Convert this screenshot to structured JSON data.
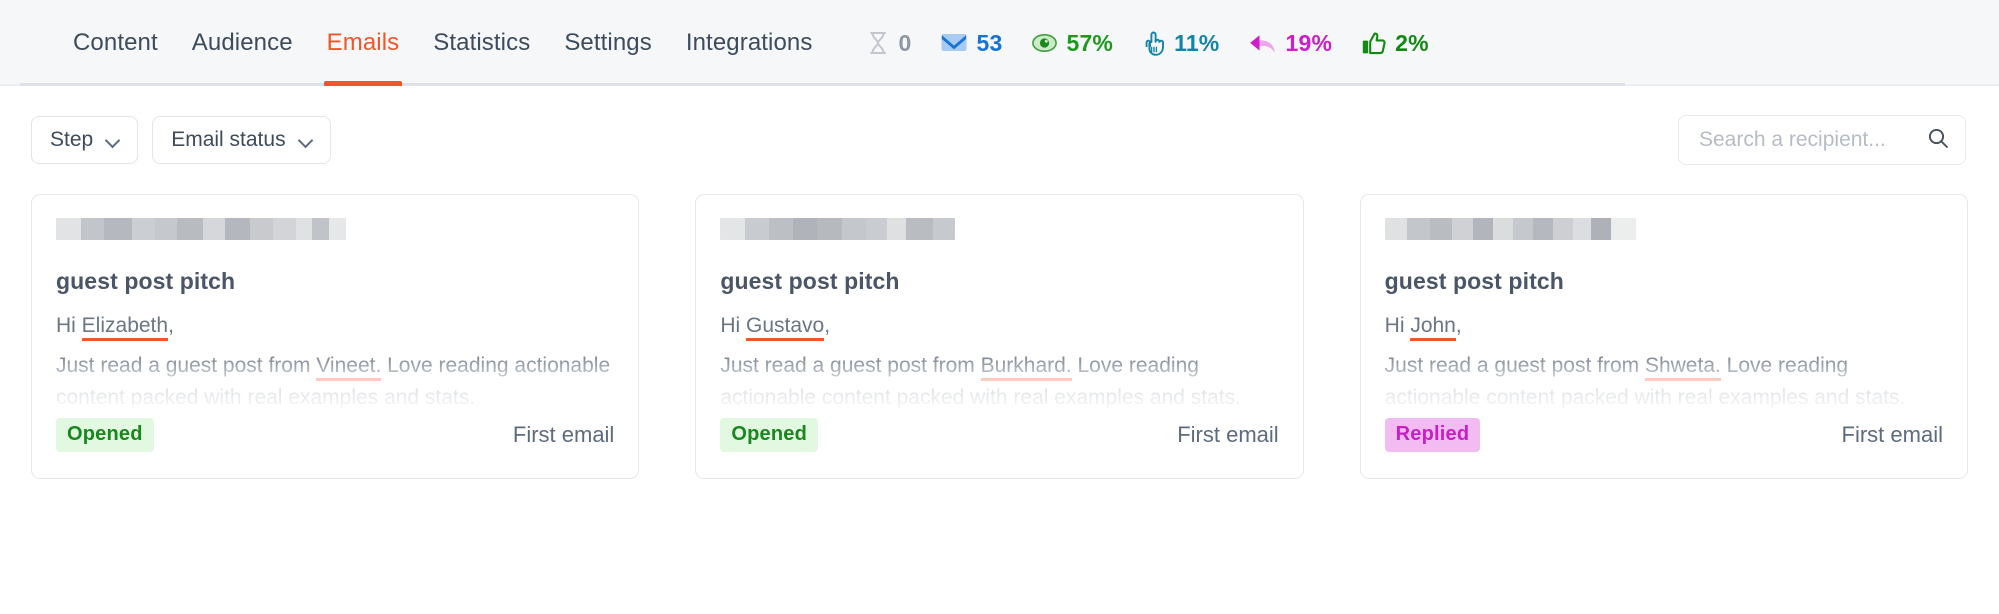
{
  "nav": {
    "tabs": [
      {
        "label": "Content",
        "active": false
      },
      {
        "label": "Audience",
        "active": false
      },
      {
        "label": "Emails",
        "active": true
      },
      {
        "label": "Statistics",
        "active": false
      },
      {
        "label": "Settings",
        "active": false
      },
      {
        "label": "Integrations",
        "active": false
      }
    ],
    "active_color": "#f1562a"
  },
  "stats": [
    {
      "name": "pending",
      "icon": "hourglass-icon",
      "value": "0",
      "color": "#8d97a4"
    },
    {
      "name": "sent",
      "icon": "envelope-icon",
      "value": "53",
      "color": "#1773d6"
    },
    {
      "name": "opened",
      "icon": "eye-icon",
      "value": "57%",
      "color": "#1b9a1b"
    },
    {
      "name": "clicked",
      "icon": "click-pointer-icon",
      "value": "11%",
      "color": "#1484a6"
    },
    {
      "name": "replied",
      "icon": "reply-arrow-icon",
      "value": "19%",
      "color": "#cc1ecc"
    },
    {
      "name": "interested",
      "icon": "thumbs-up-icon",
      "value": "2%",
      "color": "#128a12"
    }
  ],
  "toolbar": {
    "filters": [
      {
        "label": "Step",
        "name": "step-filter"
      },
      {
        "label": "Email status",
        "name": "email-status-filter"
      }
    ],
    "search": {
      "placeholder": "Search a recipient...",
      "value": ""
    }
  },
  "cards": [
    {
      "title": "guest post pitch",
      "greeting_prefix": "Hi ",
      "recipient": "Elizabeth",
      "greeting_suffix": ",",
      "body_prefix": "Just read a guest post from ",
      "author": "Vineet.",
      "body_suffix": " Love reading actionable content packed with real examples and stats.",
      "status": "Opened",
      "status_type": "opened",
      "step": "First email",
      "redact_blocks": [
        {
          "w": 9,
          "c": "#e2e3e5"
        },
        {
          "w": 8,
          "c": "#c2c5c9"
        },
        {
          "w": 10,
          "c": "#b5b9bf"
        },
        {
          "w": 8,
          "c": "#cbced2"
        },
        {
          "w": 8,
          "c": "#c5c8cd"
        },
        {
          "w": 9,
          "c": "#b8bcc1"
        },
        {
          "w": 8,
          "c": "#d5d7da"
        },
        {
          "w": 9,
          "c": "#b4b8be"
        },
        {
          "w": 8,
          "c": "#c8cace"
        },
        {
          "w": 8,
          "c": "#d2d4d7"
        },
        {
          "w": 6,
          "c": "#e0e1e3"
        },
        {
          "w": 6,
          "c": "#c0c3c8"
        },
        {
          "w": 6,
          "c": "#e6e7e9"
        }
      ]
    },
    {
      "title": "guest post pitch",
      "greeting_prefix": "Hi ",
      "recipient": "Gustavo",
      "greeting_suffix": ",",
      "body_prefix": "Just read a guest post from ",
      "author": "Burkhard.",
      "body_suffix": " Love reading actionable content packed with real examples and stats.",
      "status": "Opened",
      "status_type": "opened",
      "step": "First email",
      "redact_blocks": [
        {
          "w": 9,
          "c": "#e4e5e7"
        },
        {
          "w": 9,
          "c": "#c8cbcf"
        },
        {
          "w": 9,
          "c": "#bcc0c5"
        },
        {
          "w": 9,
          "c": "#b0b4ba"
        },
        {
          "w": 9,
          "c": "#b6babf"
        },
        {
          "w": 9,
          "c": "#c4c7cb"
        },
        {
          "w": 8,
          "c": "#c9ccd0"
        },
        {
          "w": 7,
          "c": "#dfe0e2"
        },
        {
          "w": 10,
          "c": "#b9bdc2"
        },
        {
          "w": 8,
          "c": "#c6c9cd"
        }
      ]
    },
    {
      "title": "guest post pitch",
      "greeting_prefix": "Hi ",
      "recipient": "John",
      "greeting_suffix": ",",
      "body_prefix": "Just read a guest post from ",
      "author": "Shweta.",
      "body_suffix": " Love reading actionable content packed with real examples and stats.",
      "status": "Replied",
      "status_type": "replied",
      "step": "First email",
      "redact_blocks": [
        {
          "w": 9,
          "c": "#e0e1e3"
        },
        {
          "w": 9,
          "c": "#c3c6ca"
        },
        {
          "w": 9,
          "c": "#b9bdc2"
        },
        {
          "w": 8,
          "c": "#cfd1d4"
        },
        {
          "w": 8,
          "c": "#b2b6bc"
        },
        {
          "w": 8,
          "c": "#dadcde"
        },
        {
          "w": 8,
          "c": "#c5c8cc"
        },
        {
          "w": 8,
          "c": "#b5b9bf"
        },
        {
          "w": 8,
          "c": "#cdcfd3"
        },
        {
          "w": 7,
          "c": "#dcdde0"
        },
        {
          "w": 8,
          "c": "#aeb2b8"
        },
        {
          "w": 10,
          "c": "#eceded"
        }
      ]
    }
  ]
}
